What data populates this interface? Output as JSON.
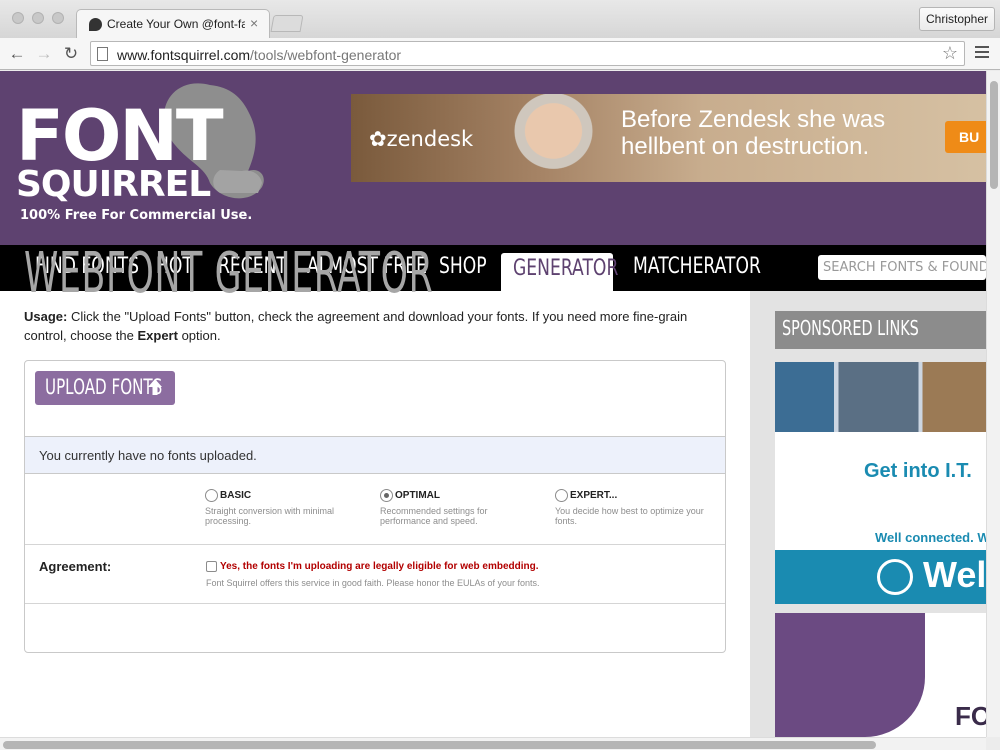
{
  "browser": {
    "tab_title": "Create Your Own @font-face",
    "profile": "Christopher",
    "url_domain": "www.fontsquirrel.com",
    "url_path": "/tools/webfont-generator"
  },
  "header": {
    "logo_line1": "FONT",
    "logo_line2": "SQUIRREL",
    "tagline": "100% Free For Commercial Use.",
    "ad": {
      "brand": "zendesk",
      "text": "Before Zendesk she was hellbent on destruction.",
      "button": "BU"
    }
  },
  "nav": {
    "items": [
      "FIND FONTS",
      "HOT",
      "RECENT",
      "ALMOST FREE",
      "SHOP",
      "GENERATOR",
      "MATCHERATOR"
    ],
    "active": "GENERATOR",
    "search_placeholder": "SEARCH FONTS & FOUNDRIES"
  },
  "main": {
    "title": "WEBFONT GENERATOR",
    "usage_label": "Usage:",
    "usage_text_1": "Click the \"Upload Fonts\" button, check the agreement and download your fonts. If you need more fine-grain control, choose the",
    "usage_expert": "Expert",
    "usage_text_2": "option.",
    "upload_button": "UPLOAD FONTS",
    "status": "You currently have no fonts uploaded.",
    "options": [
      {
        "label": "BASIC",
        "description": "Straight conversion with minimal processing.",
        "selected": false
      },
      {
        "label": "OPTIMAL",
        "description": "Recommended settings for performance and speed.",
        "selected": true
      },
      {
        "label": "EXPERT...",
        "description": "You decide how best to optimize your fonts.",
        "selected": false
      }
    ],
    "agreement_label": "Agreement:",
    "agreement_text": "Yes, the fonts I'm uploading are legally eligible for web embedding.",
    "agreement_note": "Font Squirrel offers this service in good faith. Please honor the EULAs of your fonts."
  },
  "sidebar": {
    "heading": "SPONSORED LINKS",
    "ad1_headline": "Get into I.T.",
    "ad1_tagline": "Well connected. W",
    "ad1_brand": "Wel",
    "ad2_text": "FO"
  },
  "colors": {
    "brand_purple": "#5e4270",
    "button_purple": "#8c6da0",
    "warning_red": "#b20000",
    "ad_teal": "#1a8bb1"
  }
}
